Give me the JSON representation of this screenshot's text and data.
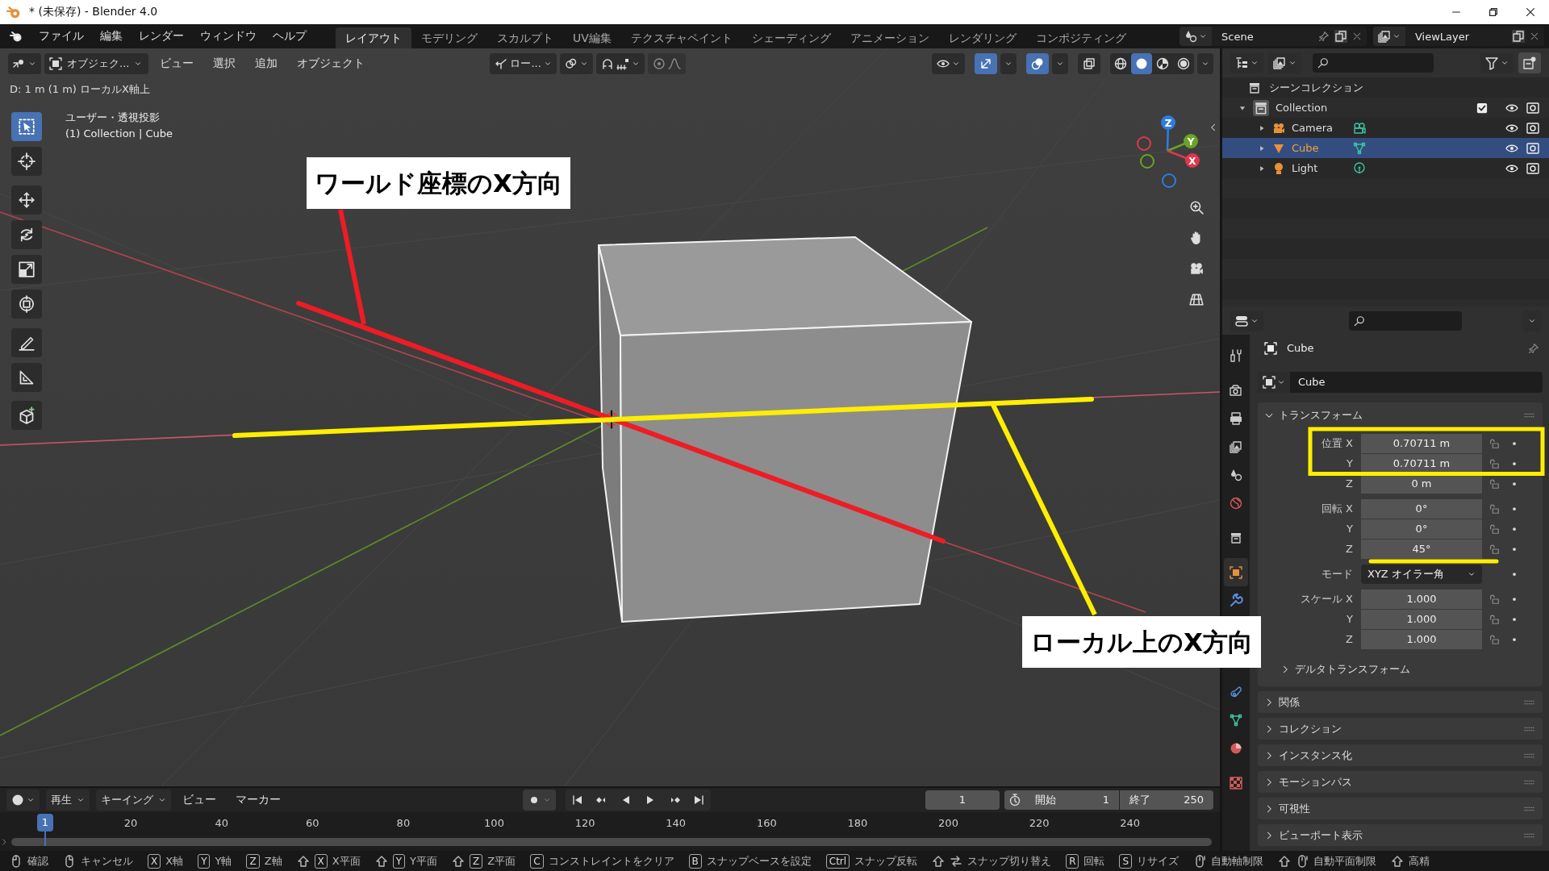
{
  "window": {
    "title": "* (未保存) - Blender 4.0"
  },
  "menu": [
    "ファイル",
    "編集",
    "レンダー",
    "ウィンドウ",
    "ヘルプ"
  ],
  "workspaces": [
    {
      "label": "レイアウト",
      "selected": true
    },
    {
      "label": "モデリング",
      "selected": false
    },
    {
      "label": "スカルプト",
      "selected": false
    },
    {
      "label": "UV編集",
      "selected": false
    },
    {
      "label": "テクスチャペイント",
      "selected": false
    },
    {
      "label": "シェーディング",
      "selected": false
    },
    {
      "label": "アニメーション",
      "selected": false
    },
    {
      "label": "レンダリング",
      "selected": false
    },
    {
      "label": "コンポジティング",
      "selected": false
    }
  ],
  "scene": {
    "name": "Scene"
  },
  "view_layer": {
    "name": "ViewLayer"
  },
  "viewport": {
    "header": {
      "mode": "オブジェク...",
      "menus": [
        "ビュー",
        "選択",
        "追加",
        "オブジェクト"
      ],
      "orientation": "ロー...",
      "toggles": [
        {
          "kind": "gizmo",
          "on": true
        },
        {
          "kind": "overlay",
          "on": true
        },
        {
          "kind": "xray",
          "on": false
        }
      ],
      "shading": [
        {
          "kind": "wireframe",
          "selected": false
        },
        {
          "kind": "solid",
          "selected": true
        },
        {
          "kind": "material",
          "selected": false
        },
        {
          "kind": "rendered",
          "selected": false
        }
      ]
    },
    "operator_info": "D: 1 m (1 m) ローカルX軸上",
    "view_name": "ユーザー・透視投影",
    "object_info": "(1) Collection | Cube",
    "tools": [
      {
        "kind": "select",
        "selected": true
      },
      {
        "kind": "cursor",
        "selected": false
      },
      {
        "kind": "move",
        "selected": false
      },
      {
        "kind": "rotate",
        "selected": false
      },
      {
        "kind": "scale",
        "selected": false
      },
      {
        "kind": "transform",
        "selected": false
      },
      {
        "kind": "annotate",
        "selected": false
      },
      {
        "kind": "measure",
        "selected": false
      },
      {
        "kind": "add_cube",
        "selected": false
      }
    ],
    "gizmo_axes": [
      {
        "label": "Z",
        "color": "#2f7ce0"
      },
      {
        "label": "Y",
        "color": "#6aa326"
      },
      {
        "label": "X",
        "color": "#e0374d"
      }
    ],
    "annotations": [
      {
        "label": "ワールド座標のX方向"
      },
      {
        "label": "ローカル上のX方向"
      }
    ]
  },
  "outliner": {
    "root": "シーンコレクション",
    "items": [
      {
        "label": "Collection",
        "kind": "collection",
        "expanded": true,
        "checked": true,
        "selected": false,
        "children": [
          {
            "label": "Camera",
            "kind": "camera",
            "expanded": false,
            "selected": false
          },
          {
            "label": "Cube",
            "kind": "mesh",
            "expanded": false,
            "selected": true
          },
          {
            "label": "Light",
            "kind": "light",
            "expanded": false,
            "selected": false
          }
        ]
      }
    ]
  },
  "properties": {
    "tab_groups": [
      [
        {
          "kind": "tool",
          "selected": false
        }
      ],
      [
        {
          "kind": "render",
          "selected": false
        },
        {
          "kind": "output",
          "selected": false
        },
        {
          "kind": "view_layer",
          "selected": false
        },
        {
          "kind": "scene",
          "selected": false
        },
        {
          "kind": "world",
          "selected": false
        }
      ],
      [
        {
          "kind": "collection",
          "selected": false
        }
      ],
      [
        {
          "kind": "object",
          "selected": true
        },
        {
          "kind": "modifier",
          "selected": false
        }
      ],
      [
        {
          "kind": "constraint",
          "selected": false
        },
        {
          "kind": "data",
          "selected": false
        },
        {
          "kind": "material",
          "selected": false
        }
      ],
      [
        {
          "kind": "texture",
          "selected": false
        }
      ]
    ],
    "object_name": "Cube",
    "datablock": "Cube",
    "transform": {
      "title": "トランスフォーム",
      "expanded": true,
      "groups": [
        [
          {
            "kind": "number",
            "label": "位置 X",
            "value": "0.70711 m"
          },
          {
            "kind": "number",
            "label": "Y",
            "value": "0.70711 m"
          },
          {
            "kind": "number",
            "label": "Z",
            "value": "0 m"
          }
        ],
        [
          {
            "kind": "number",
            "label": "回転 X",
            "value": "0°"
          },
          {
            "kind": "number",
            "label": "Y",
            "value": "0°"
          },
          {
            "kind": "number",
            "label": "Z",
            "value": "45°"
          }
        ],
        [
          {
            "kind": "dropdown",
            "label": "モード",
            "value": "XYZ オイラー角"
          }
        ],
        [
          {
            "kind": "number",
            "label": "スケール X",
            "value": "1.000"
          },
          {
            "kind": "number",
            "label": "Y",
            "value": "1.000"
          },
          {
            "kind": "number",
            "label": "Z",
            "value": "1.000"
          }
        ]
      ],
      "subpanels": [
        {
          "title": "デルタトランスフォーム",
          "expanded": false
        }
      ]
    },
    "panels": [
      {
        "title": "関係",
        "expanded": false
      },
      {
        "title": "コレクション",
        "expanded": false
      },
      {
        "title": "インスタンス化",
        "expanded": false
      },
      {
        "title": "モーションパス",
        "expanded": false
      },
      {
        "title": "可視性",
        "expanded": false
      },
      {
        "title": "ビューポート表示",
        "expanded": false
      }
    ]
  },
  "timeline": {
    "menus": [
      {
        "label": "再生",
        "dropdown": true
      },
      {
        "label": "キーイング",
        "dropdown": true
      },
      {
        "label": "ビュー",
        "dropdown": false
      },
      {
        "label": "マーカー",
        "dropdown": false
      }
    ],
    "current_frame": "1",
    "start_label": "開始",
    "start": "1",
    "end_label": "終了",
    "end": "250",
    "playhead": "1",
    "ruler": [
      "20",
      "40",
      "60",
      "80",
      "100",
      "120",
      "140",
      "160",
      "180",
      "200",
      "220",
      "240"
    ]
  },
  "status_bar": [
    {
      "keys": [
        {
          "kind": "mouse_left"
        }
      ],
      "label": "確認"
    },
    {
      "keys": [
        {
          "kind": "mouse_right"
        }
      ],
      "label": "キャンセル"
    },
    {
      "keys": [
        {
          "kind": "text",
          "label": "X"
        }
      ],
      "label": "X軸"
    },
    {
      "keys": [
        {
          "kind": "text",
          "label": "Y"
        }
      ],
      "label": "Y軸"
    },
    {
      "keys": [
        {
          "kind": "text",
          "label": "Z"
        }
      ],
      "label": "Z軸"
    },
    {
      "keys": [
        {
          "kind": "shift"
        },
        {
          "kind": "text",
          "label": "X"
        }
      ],
      "label": "X平面"
    },
    {
      "keys": [
        {
          "kind": "shift"
        },
        {
          "kind": "text",
          "label": "Y"
        }
      ],
      "label": "Y平面"
    },
    {
      "keys": [
        {
          "kind": "shift"
        },
        {
          "kind": "text",
          "label": "Z"
        }
      ],
      "label": "Z平面"
    },
    {
      "keys": [
        {
          "kind": "text",
          "label": "C"
        }
      ],
      "label": "コンストレイントをクリア"
    },
    {
      "keys": [
        {
          "kind": "text",
          "label": "B"
        }
      ],
      "label": "スナップベースを設定"
    },
    {
      "keys": [
        {
          "kind": "text",
          "label": "Ctrl"
        }
      ],
      "label": "スナップ反転"
    },
    {
      "keys": [
        {
          "kind": "shift"
        },
        {
          "kind": "tab"
        }
      ],
      "label": "スナップ切り替え"
    },
    {
      "keys": [
        {
          "kind": "text",
          "label": "R"
        }
      ],
      "label": "回転"
    },
    {
      "keys": [
        {
          "kind": "text",
          "label": "S"
        }
      ],
      "label": "リサイズ"
    },
    {
      "keys": [
        {
          "kind": "mouse_middle"
        }
      ],
      "label": "自動軸制限"
    },
    {
      "keys": [
        {
          "kind": "shift"
        },
        {
          "kind": "mouse_middle"
        }
      ],
      "label": "自動平面制限"
    },
    {
      "keys": [
        {
          "kind": "shift"
        }
      ],
      "label": "高精"
    }
  ]
}
